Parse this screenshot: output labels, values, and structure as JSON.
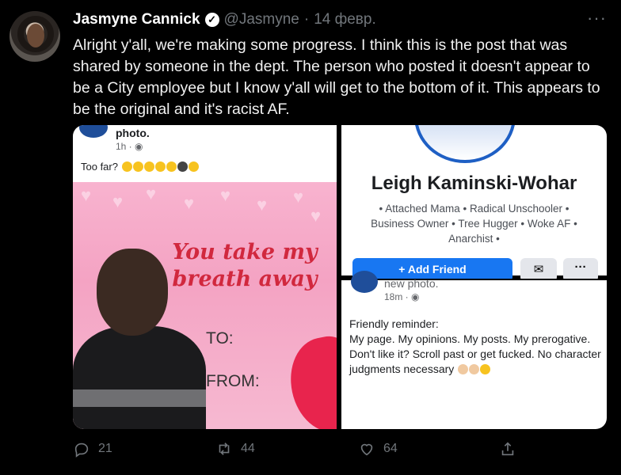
{
  "tweet": {
    "name": "Jasmyne Cannick",
    "handle": "@Jasmyne",
    "separator": "·",
    "date": "14 февр.",
    "more": "···",
    "text": "Alright y'all, we're making some progress.  I think this is the post that was shared by someone in the dept.  The person who posted it doesn't appear to be a City employee but I know y'all will get to the bottom of it. This appears to be the original and it's racist AF."
  },
  "left_post": {
    "header": "photo.",
    "meta": "1h · ",
    "caption": "Too far? ",
    "card": {
      "line": "You take my breath away",
      "to": "TO:",
      "from": "FROM:"
    }
  },
  "profile": {
    "name": "Leigh Kaminski-Wohar",
    "bio": "• Attached Mama • Radical Unschooler • Business Owner • Tree Hugger • Woke AF • Anarchist •",
    "add_friend": "Add Friend",
    "more": "···"
  },
  "second_post": {
    "header": "new photo.",
    "meta": "18m · ",
    "lines": [
      "Friendly reminder:",
      "My page. My opinions. My posts. My prerogative.",
      "Don't like it? Scroll past or get fucked. No character judgments necessary"
    ]
  },
  "actions": {
    "replies": "21",
    "retweets": "44",
    "likes": "64"
  },
  "colors": {
    "background": "#000000",
    "muted": "#71767b",
    "facebook_blue": "#1877f2",
    "card_pink": "#f4a3c3",
    "card_red": "#d1283e"
  }
}
